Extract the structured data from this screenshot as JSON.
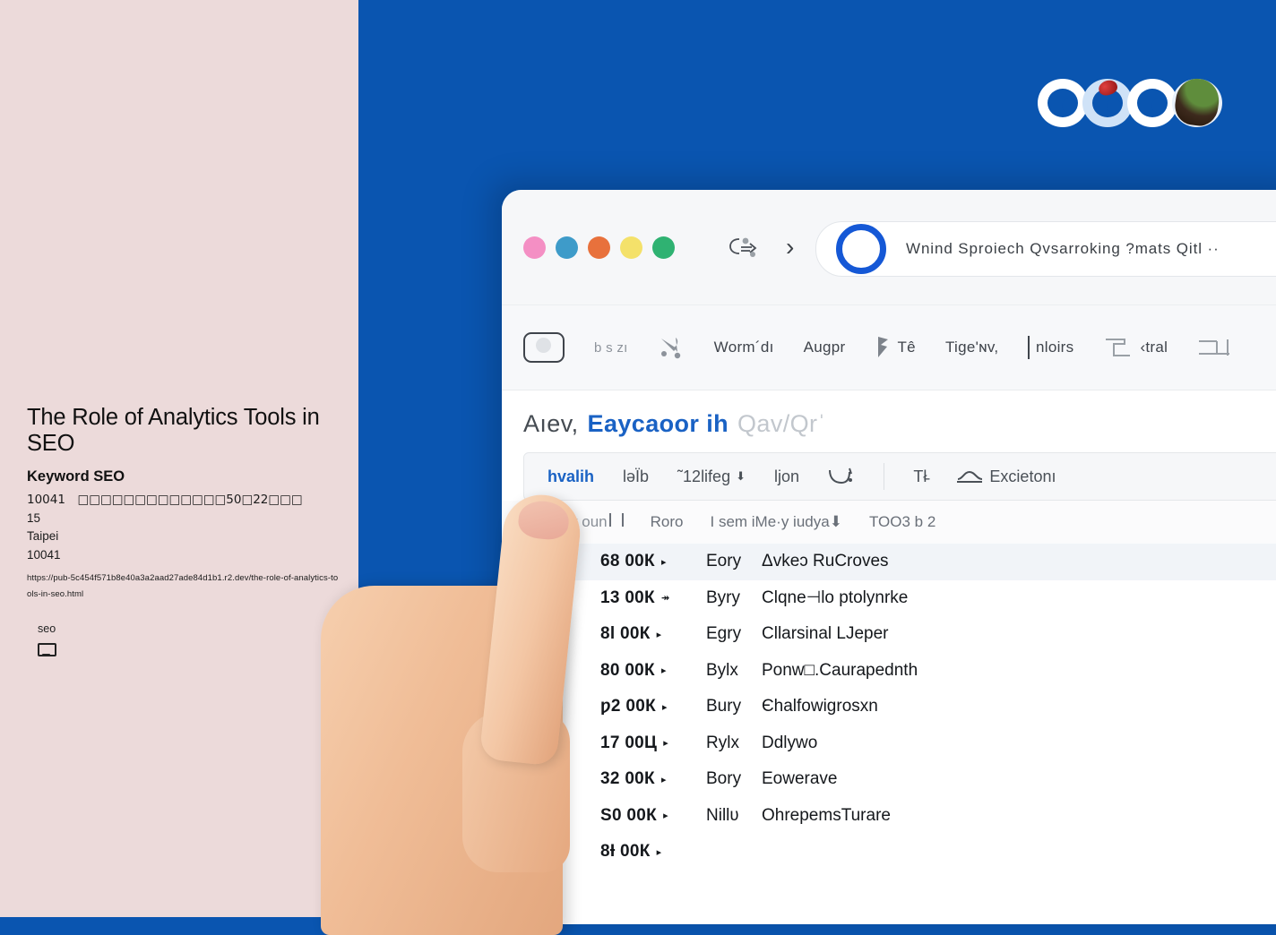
{
  "colors": {
    "background_blue": "#0A55B0",
    "panel_pink": "#ECDADA",
    "accent_blue": "#1A62C4",
    "omnibox_ring_blue": "#1558D6"
  },
  "article": {
    "title": "The Role of Analytics Tools in SEO",
    "kicker": "Keyword SEO",
    "address_line": "10041　□□□□□□□□□□□□□50□22□□□",
    "number": "15",
    "city": "Taipei",
    "postal": "10041",
    "url": "https://pub-5c454f571b8e40a3a2aad27ade84d1b1.r2.dev/the-role-of-analytics-tools-in-seo.html",
    "tag_label": "seo"
  },
  "browser": {
    "traffic_lights": [
      {
        "name": "pink",
        "color": "#F48FC4"
      },
      {
        "name": "blue",
        "color": "#3E9BC9"
      },
      {
        "name": "orange",
        "color": "#E8713C"
      },
      {
        "name": "yellow",
        "color": "#F4E16A"
      },
      {
        "name": "green",
        "color": "#2FB272"
      }
    ],
    "nav": {
      "people_icon": "people-chat-icon",
      "forward_chevron": "›"
    },
    "omnibox": {
      "ring_icon": "blue-ring-icon",
      "value": "Wnind Sproiech  Qvsarroking ?mats  Qitl  ··"
    },
    "toolbar": [
      {
        "icon": "home-rect-icon",
        "label": ""
      },
      {
        "icon": "",
        "label": "b s zı"
      },
      {
        "icon": "scissors-icon",
        "label": ""
      },
      {
        "icon": "",
        "label": "Worm´dı"
      },
      {
        "icon": "",
        "label": "Augpr"
      },
      {
        "icon": "flag-icon",
        "label": "Tê"
      },
      {
        "icon": "",
        "label": "Tige'ɴv,"
      },
      {
        "icon": "bar-divider-icon",
        "label": "nloirs"
      },
      {
        "icon": "box-icon",
        "label": "‹tral"
      },
      {
        "icon": "box-outline-icon",
        "label": ""
      }
    ],
    "heading": {
      "pre": "Aıev,",
      "accent": "Eaycaoor ih",
      "muted": "Qav/Qrˈ"
    },
    "filter_bar": [
      {
        "label": "hvalih",
        "style": "accent"
      },
      {
        "label": "ləЇb",
        "style": "normal"
      },
      {
        "label": "˜12lifeg",
        "style": "normal",
        "caret": "⬇"
      },
      {
        "label": "ljon",
        "style": "normal"
      },
      {
        "icon": "cart-icon",
        "label": ""
      },
      {
        "icon": "divider",
        "label": ""
      },
      {
        "label": "Tł̵",
        "style": "normal"
      },
      {
        "icon": "shoe-icon",
        "label": "Excietonı"
      }
    ],
    "column_headers": [
      "Hly oun",
      "Roro",
      "I sem iMe·y iudya⬇",
      "TOO3 b 2"
    ],
    "rows": [
      {
        "metric": "68 00К",
        "caret": "▸",
        "code": "Eory",
        "name": "Δvkeɔ  RuCroves",
        "highlighted": true
      },
      {
        "metric": "13 00К",
        "caret": "↠",
        "code": "Byry",
        "name": "Clqne⊣lo ptolynrke",
        "highlighted": false
      },
      {
        "metric": "8l  00К",
        "caret": "▸",
        "code": "Egry",
        "name": "Cllarsinal LJeper",
        "highlighted": false
      },
      {
        "metric": "80 00К",
        "caret": "▸",
        "code": "Bylх",
        "name": "Ponw□.Caurapednth",
        "highlighted": false
      },
      {
        "metric": "ƿ2 00К",
        "caret": "▸",
        "code": "Bury",
        "name": "Єhalfowigrosxn",
        "highlighted": false
      },
      {
        "metric": "17 00Ц",
        "caret": "▸",
        "code": "Rylх",
        "name": "Ddlywo",
        "highlighted": false
      },
      {
        "metric": "32 00К",
        "caret": "▸",
        "code": "Bory",
        "name": "Eowerave",
        "highlighted": false
      },
      {
        "metric": "S0 00К",
        "caret": "▸",
        "code": "Nillʋ",
        "name": "OhrepemsTurare",
        "highlighted": false
      },
      {
        "metric": "8Ɨ 00К",
        "caret": "▸",
        "code": "",
        "name": "",
        "highlighted": false
      }
    ]
  },
  "logo": {
    "name": "brand-rings-logo",
    "red_dot": "#C32020",
    "blob": "#3D2A1D"
  },
  "hand": {
    "name": "pointing-hand-illustration"
  }
}
